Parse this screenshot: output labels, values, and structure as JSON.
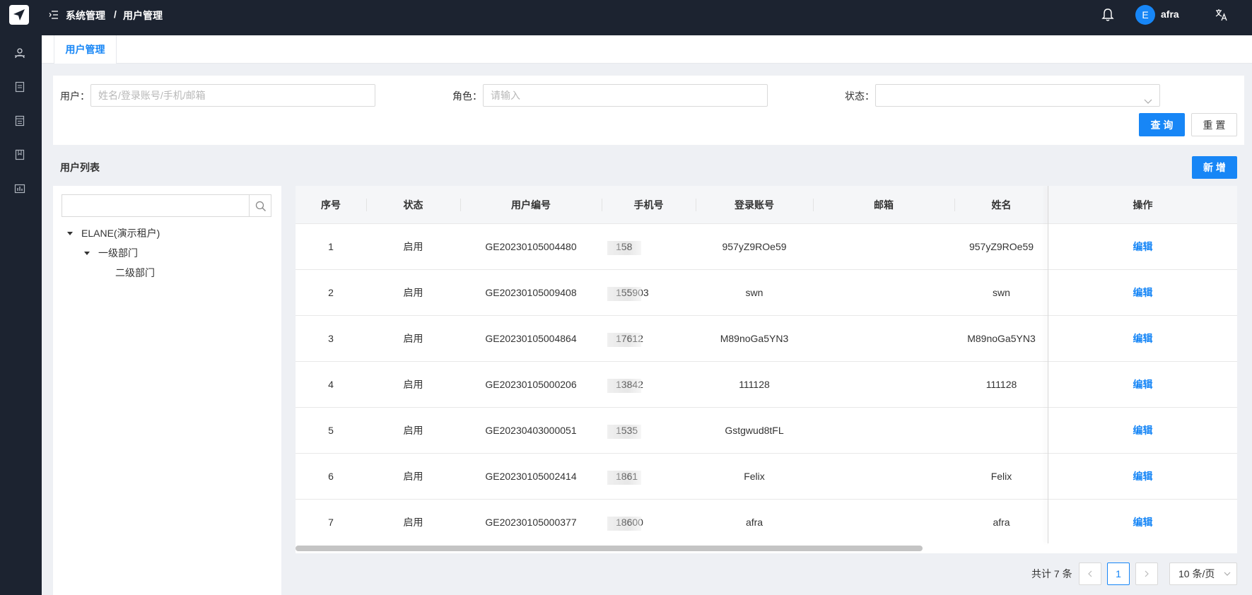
{
  "header": {
    "breadcrumb_parent": "系统管理",
    "breadcrumb_separator": "/",
    "breadcrumb_current": "用户管理",
    "avatar_initial": "E",
    "user_name": "afra"
  },
  "tabs": [
    {
      "label": "用户管理",
      "active": true
    }
  ],
  "search": {
    "user_label": "用户：",
    "user_placeholder": "姓名/登录账号/手机/邮箱",
    "role_label": "角色：",
    "role_placeholder": "请输入",
    "status_label": "状态：",
    "status_value": "",
    "query_button": "查 询",
    "reset_button": "重 置"
  },
  "list": {
    "title": "用户列表",
    "add_button": "新 增"
  },
  "tree": {
    "search_placeholder": "",
    "nodes": [
      {
        "label": "ELANE(演示租户)",
        "level": 0,
        "expanded": true
      },
      {
        "label": "一级部门",
        "level": 1,
        "expanded": true
      },
      {
        "label": "二级部门",
        "level": 2,
        "expanded": false
      }
    ]
  },
  "table": {
    "columns": [
      "序号",
      "状态",
      "用户编号",
      "手机号",
      "登录账号",
      "邮箱",
      "姓名",
      "操作"
    ],
    "rows": [
      {
        "index": "1",
        "status": "启用",
        "code": "GE20230105004480",
        "phone": "158",
        "account": "957yZ9ROe59",
        "email": "",
        "name": "957yZ9ROe59",
        "action": "编辑"
      },
      {
        "index": "2",
        "status": "启用",
        "code": "GE20230105009408",
        "phone": "155903",
        "account": "swn",
        "email": "",
        "name": "swn",
        "action": "编辑"
      },
      {
        "index": "3",
        "status": "启用",
        "code": "GE20230105004864",
        "phone": "17612",
        "account": "M89noGa5YN3",
        "email": "",
        "name": "M89noGa5YN3",
        "action": "编辑"
      },
      {
        "index": "4",
        "status": "启用",
        "code": "GE20230105000206",
        "phone": "13842",
        "account": "111128",
        "email": "",
        "name": "111128",
        "action": "编辑"
      },
      {
        "index": "5",
        "status": "启用",
        "code": "GE20230403000051",
        "phone": "1535",
        "account": "Gstgwud8tFL",
        "email": "",
        "name": "",
        "action": "编辑"
      },
      {
        "index": "6",
        "status": "启用",
        "code": "GE20230105002414",
        "phone": "1861",
        "account": "Felix",
        "email": "",
        "name": "Felix",
        "action": "编辑"
      },
      {
        "index": "7",
        "status": "启用",
        "code": "GE20230105000377",
        "phone": "18600",
        "account": "afra",
        "email": "",
        "name": "afra",
        "action": "编辑"
      }
    ]
  },
  "pagination": {
    "total_text": "共计 7 条",
    "current_page": "1",
    "prev_icon": "chevron-left-icon",
    "next_icon": "chevron-right-icon",
    "page_size": "10 条/页"
  },
  "colors": {
    "primary": "#1786f6",
    "nav_bg": "#1c2330",
    "page_bg": "#eef0f4"
  },
  "icons": [
    "paper-plane-logo-icon",
    "user-group-icon",
    "document-icon",
    "list-doc-icon",
    "bookmark-icon",
    "report-icon",
    "menu-fold-icon",
    "bell-icon",
    "translate-icon",
    "search-icon",
    "chevron-down-icon"
  ]
}
